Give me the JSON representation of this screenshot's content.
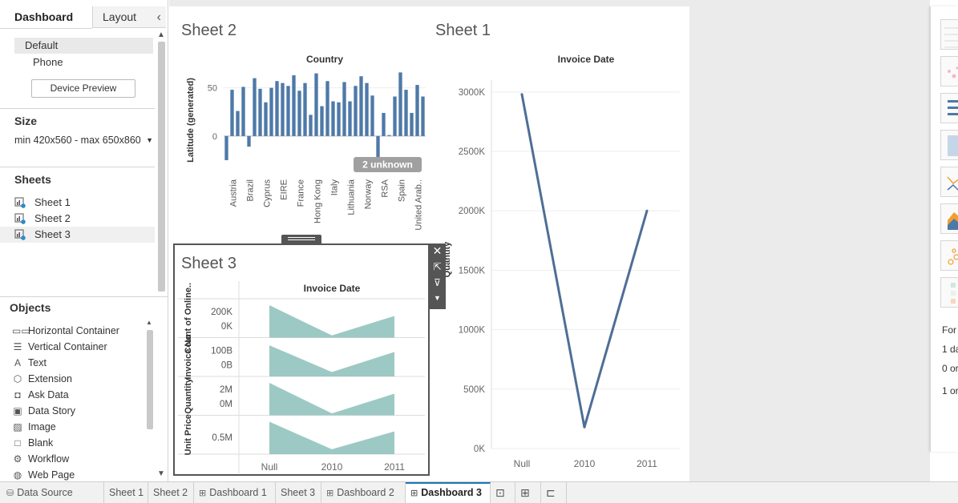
{
  "left_panel": {
    "tabs": {
      "dashboard": "Dashboard",
      "layout": "Layout"
    },
    "device": {
      "default": "Default",
      "phone": "Phone",
      "preview_button": "Device Preview"
    },
    "size": {
      "title": "Size",
      "value": "min 420x560 - max 650x860"
    },
    "sheets": {
      "title": "Sheets",
      "items": [
        "Sheet 1",
        "Sheet 2",
        "Sheet 3"
      ]
    },
    "objects": {
      "title": "Objects",
      "items": [
        {
          "label": "Horizontal Container",
          "icon": "horizontal-container-icon"
        },
        {
          "label": "Vertical Container",
          "icon": "vertical-container-icon"
        },
        {
          "label": "Text",
          "icon": "text-icon"
        },
        {
          "label": "Extension",
          "icon": "extension-icon"
        },
        {
          "label": "Ask Data",
          "icon": "ask-data-icon"
        },
        {
          "label": "Data Story",
          "icon": "data-story-icon"
        },
        {
          "label": "Image",
          "icon": "image-icon"
        },
        {
          "label": "Blank",
          "icon": "blank-icon"
        },
        {
          "label": "Workflow",
          "icon": "workflow-icon"
        },
        {
          "label": "Web Page",
          "icon": "web-page-icon"
        }
      ]
    }
  },
  "dashboard": {
    "sheet2": {
      "title": "Sheet 2",
      "chart_title": "Country",
      "unknown_badge": "2 unknown"
    },
    "sheet1": {
      "title": "Sheet 1",
      "chart_title": "Invoice Date",
      "partial_axis_label": "Quantity"
    },
    "sheet3": {
      "title": "Sheet 3",
      "chart_title": "Invoice Date"
    }
  },
  "chart_data": [
    {
      "type": "bar",
      "title": "Country",
      "ylabel": "Latitude (generated)",
      "ylim": [
        -35,
        68
      ],
      "yticks": [
        0,
        50
      ],
      "tick_labels": [
        "Austria",
        "Brazil",
        "Cyprus",
        "EIRE",
        "France",
        "Hong Kong",
        "Italy",
        "Lithuania",
        "Norway",
        "RSA",
        "Spain",
        "United Arab.."
      ],
      "values": [
        -25,
        48,
        26,
        51,
        -11,
        60,
        49,
        35,
        50,
        57,
        55,
        52,
        63,
        47,
        55,
        22,
        65,
        31,
        57,
        36,
        35,
        56,
        36,
        52,
        62,
        55,
        42,
        -34,
        24,
        1,
        41,
        66,
        48,
        24,
        53,
        41
      ],
      "annotation": "2 unknown",
      "color": "#4e79a7"
    },
    {
      "type": "line",
      "title": "Invoice Date",
      "ylabel": "Quantity",
      "x": [
        "Null",
        "2010",
        "2011"
      ],
      "y": [
        2980000,
        180000,
        2000000
      ],
      "ylim": [
        0,
        3100000
      ],
      "yticks": [
        "0K",
        "500K",
        "1000K",
        "1500K",
        "2000K",
        "2500K",
        "3000K"
      ],
      "color": "#4e6e96"
    },
    {
      "type": "area",
      "title": "Invoice Date",
      "x": [
        "Null",
        "2010",
        "2011"
      ],
      "color": "#8cc0ba",
      "panes": [
        {
          "label": "Count of Online..",
          "ticks": [
            "200K",
            "0K"
          ],
          "values": [
            300000,
            20000,
            200000
          ],
          "ylim": [
            0,
            330000
          ]
        },
        {
          "label": "Invoice No",
          "ticks": [
            "100B",
            "0B"
          ],
          "values": [
            140,
            20,
            110
          ],
          "ylim": [
            0,
            160
          ]
        },
        {
          "label": "Quantity",
          "ticks": [
            "2M",
            "0M"
          ],
          "values": [
            3.0,
            0.18,
            2.0
          ],
          "ylim": [
            0,
            3.3
          ]
        },
        {
          "label": "Unit Price",
          "ticks": [
            "0.5M"
          ],
          "values": [
            1.0,
            0.15,
            0.7
          ],
          "ylim": [
            0,
            1.1
          ]
        }
      ]
    }
  ],
  "right_panel": {
    "lines": [
      "For",
      "1 da",
      "0 or",
      "1 or"
    ]
  },
  "bottom_tabs": [
    {
      "label": "Data Source",
      "icon": "database-icon"
    },
    {
      "label": "Sheet 1",
      "icon": ""
    },
    {
      "label": "Sheet 2",
      "icon": ""
    },
    {
      "label": "Dashboard 1",
      "icon": "dashboard-icon"
    },
    {
      "label": "Sheet 3",
      "icon": ""
    },
    {
      "label": "Dashboard 2",
      "icon": "dashboard-icon"
    },
    {
      "label": "Dashboard 3",
      "icon": "dashboard-icon"
    }
  ]
}
